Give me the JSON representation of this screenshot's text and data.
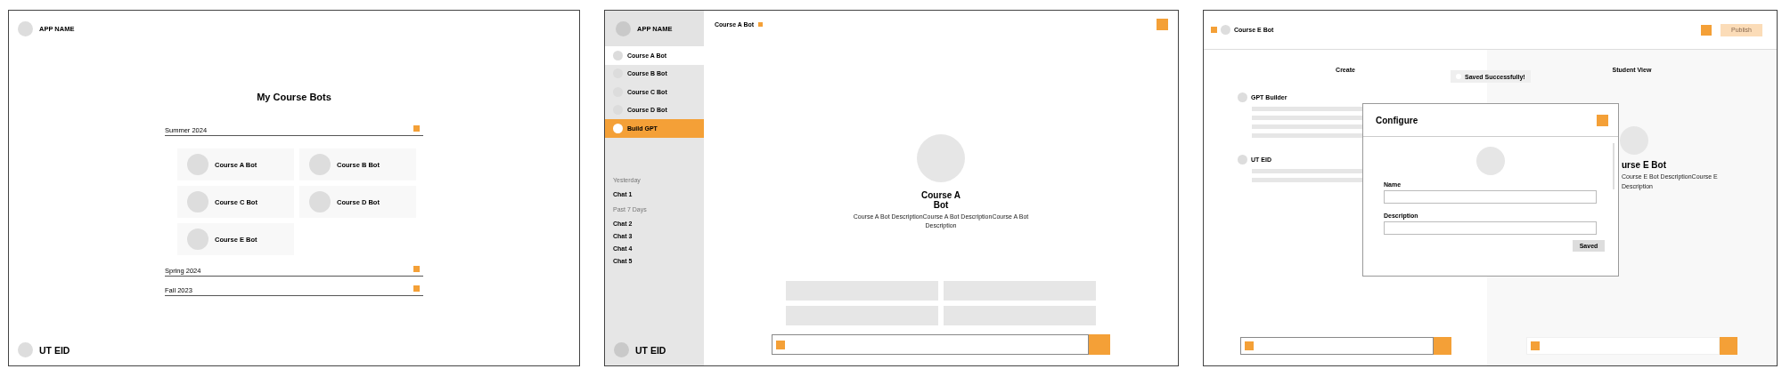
{
  "home": {
    "app_name": "APP NAME",
    "title": "My Course Bots",
    "user": "UT EID",
    "terms": [
      {
        "label": "Summer 2024",
        "bots": [
          "Course A Bot",
          "Course B Bot",
          "Course C Bot",
          "Course D Bot",
          "Course E Bot"
        ]
      },
      {
        "label": "Spring 2024"
      },
      {
        "label": "Fall 2023"
      }
    ]
  },
  "chat": {
    "app_name": "APP NAME",
    "user": "UT EID",
    "header_title": "Course A Bot",
    "bot_title": "Course A Bot",
    "bot_description": "Course A Bot DescriptionCourse A Bot DescriptionCourse A Bot Description",
    "bots": [
      {
        "label": "Course A Bot",
        "kind": "bot",
        "selected": true
      },
      {
        "label": "Course B Bot",
        "kind": "bot",
        "selected": false
      },
      {
        "label": "Course C Bot",
        "kind": "bot",
        "selected": false
      },
      {
        "label": "Course D Bot",
        "kind": "bot",
        "selected": false
      },
      {
        "label": "Build GPT",
        "kind": "action",
        "selected": false
      }
    ],
    "history": [
      {
        "heading": "Yesterday",
        "chats": [
          "Chat 1"
        ]
      },
      {
        "heading": "Past 7 Days",
        "chats": [
          "Chat 2",
          "Chat 3",
          "Chat 4",
          "Chat 5"
        ]
      }
    ]
  },
  "builder": {
    "bot_name": "Course E Bot",
    "publish": {
      "label": "Publish",
      "disabled": true
    },
    "create_heading": "Create",
    "toast": "Saved Successfully!",
    "student_heading": "Student View",
    "sections": [
      "GPT Builder",
      "UT EID"
    ],
    "student_title": "urse E Bot",
    "student_description": [
      "Course E Bot DescriptionCourse E",
      "Description"
    ],
    "dialog": {
      "title": "Configure",
      "fields": [
        "Name",
        "Description"
      ],
      "button": "Saved"
    }
  }
}
